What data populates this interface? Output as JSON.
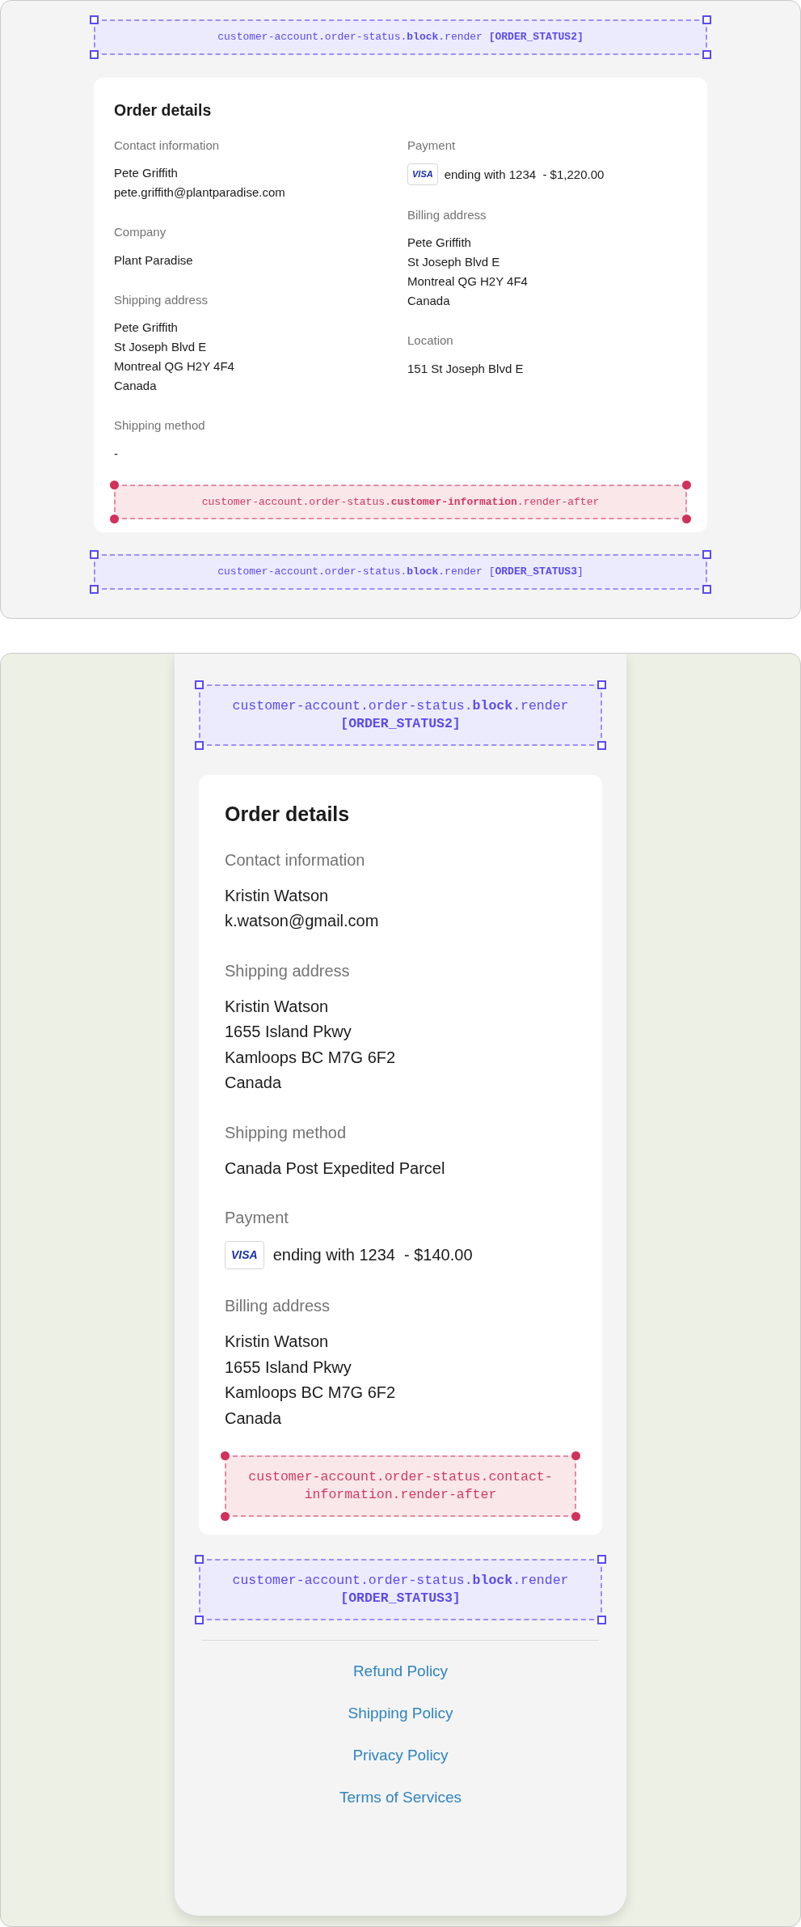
{
  "panels": [
    {
      "kind": "desktop",
      "top_target": {
        "kind": "block",
        "text": "customer-account.order-status.**block**.render **[ORDER_STATUS2]**"
      },
      "card": {
        "title": "Order details",
        "columns": [
          [
            {
              "kind": "text",
              "label": "Contact information",
              "lines": [
                "Pete Griffith",
                "pete.griffith@plantparadise.com"
              ]
            },
            {
              "kind": "text",
              "label": "Company",
              "lines": [
                "Plant Paradise"
              ]
            },
            {
              "kind": "text",
              "label": "Shipping address",
              "lines": [
                "Pete Griffith",
                "St Joseph Blvd E",
                "Montreal QG H2Y 4F4",
                "Canada"
              ]
            },
            {
              "kind": "text",
              "label": "Shipping method",
              "lines": [
                "-"
              ]
            }
          ],
          [
            {
              "kind": "payment",
              "label": "Payment",
              "brand": "VISA",
              "lines": [
                "ending with 1234  - $1,220.00"
              ]
            },
            {
              "kind": "text",
              "label": "Billing address",
              "lines": [
                "Pete Griffith",
                "St Joseph Blvd E",
                "Montreal QG H2Y 4F4",
                "Canada"
              ]
            },
            {
              "kind": "text",
              "label": "Location",
              "lines": [
                "151 St Joseph Blvd E"
              ]
            }
          ]
        ],
        "target": {
          "kind": "render-after",
          "text": "customer-account.order-status.**customer-information**.render-after"
        }
      },
      "bottom_target": {
        "kind": "block",
        "text": "customer-account.order-status.**block**.render [**ORDER_STATUS3**]"
      }
    },
    {
      "kind": "mobile",
      "top_target": {
        "kind": "block",
        "text": "customer-account.order-status.**block**.render **[ORDER_STATUS2]**"
      },
      "card": {
        "title": "Order details",
        "columns": [
          [
            {
              "kind": "text",
              "label": "Contact information",
              "lines": [
                "Kristin Watson",
                "k.watson@gmail.com"
              ]
            },
            {
              "kind": "text",
              "label": "Shipping address",
              "lines": [
                "Kristin Watson",
                "1655 Island Pkwy",
                "Kamloops BC M7G 6F2",
                "Canada"
              ]
            },
            {
              "kind": "text",
              "label": "Shipping method",
              "lines": [
                "Canada Post Expedited Parcel"
              ]
            },
            {
              "kind": "payment",
              "label": "Payment",
              "brand": "VISA",
              "lines": [
                "ending with 1234  - $140.00"
              ]
            },
            {
              "kind": "text",
              "label": "Billing address",
              "lines": [
                "Kristin Watson",
                "1655 Island Pkwy",
                "Kamloops BC M7G 6F2",
                "Canada"
              ]
            }
          ]
        ],
        "target": {
          "kind": "render-after",
          "text": "customer-account.order-status.contact-information.render-after"
        }
      },
      "bottom_target": {
        "kind": "block",
        "text": "customer-account.order-status.**block**.render **[ORDER_STATUS3]**"
      },
      "footer_links": [
        "Refund Policy",
        "Shipping Policy",
        "Privacy Policy",
        "Terms of Services"
      ]
    }
  ]
}
